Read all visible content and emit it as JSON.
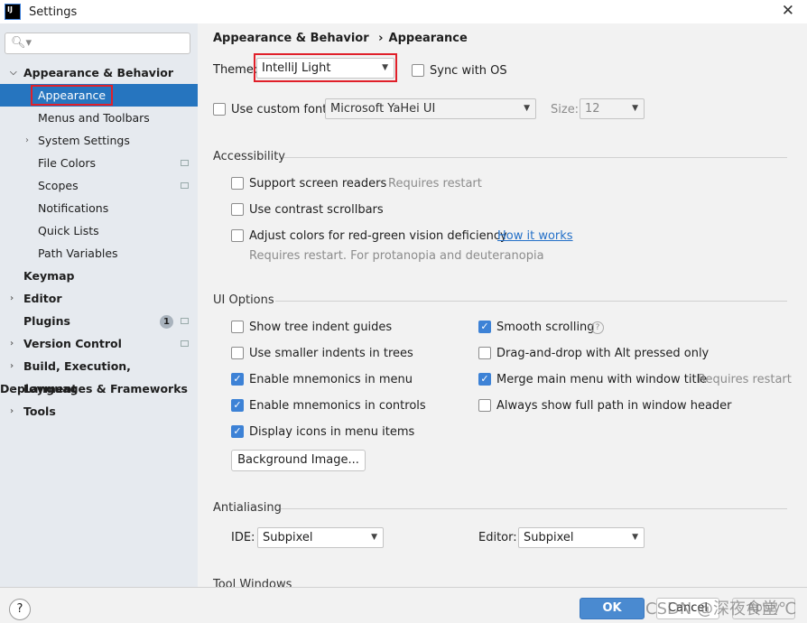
{
  "window": {
    "title": "Settings",
    "logo": "IJ"
  },
  "sidebar": {
    "search_placeholder": "",
    "items": [
      {
        "label": "Appearance & Behavior"
      },
      {
        "label": "Appearance"
      },
      {
        "label": "Menus and Toolbars"
      },
      {
        "label": "System Settings"
      },
      {
        "label": "File Colors"
      },
      {
        "label": "Scopes"
      },
      {
        "label": "Notifications"
      },
      {
        "label": "Quick Lists"
      },
      {
        "label": "Path Variables"
      },
      {
        "label": "Keymap"
      },
      {
        "label": "Editor"
      },
      {
        "label": "Plugins",
        "badge": "1"
      },
      {
        "label": "Version Control"
      },
      {
        "label": "Build, Execution, Deployment"
      },
      {
        "label": "Languages & Frameworks"
      },
      {
        "label": "Tools"
      }
    ]
  },
  "breadcrumb": {
    "parent": "Appearance & Behavior",
    "sep": "›",
    "current": "Appearance"
  },
  "theme": {
    "label": "Theme:",
    "value": "IntelliJ Light",
    "sync": "Sync with OS"
  },
  "font": {
    "label": "Use custom font:",
    "value": "Microsoft YaHei UI",
    "size_label": "Size:",
    "size": "12"
  },
  "accessibility": {
    "title": "Accessibility",
    "screen_readers": "Support screen readers",
    "requires_restart": "Requires restart",
    "contrast": "Use contrast scrollbars",
    "color_def": "Adjust colors for red-green vision deficiency",
    "how": "How it works",
    "note": "Requires restart. For protanopia and deuteranopia"
  },
  "ui": {
    "title": "UI Options",
    "left": [
      {
        "label": "Show tree indent guides",
        "checked": false
      },
      {
        "label": "Use smaller indents in trees",
        "checked": false
      },
      {
        "label": "Enable mnemonics in menu",
        "checked": true
      },
      {
        "label": "Enable mnemonics in controls",
        "checked": true
      },
      {
        "label": "Display icons in menu items",
        "checked": true
      }
    ],
    "right": [
      {
        "label": "Smooth scrolling",
        "checked": true
      },
      {
        "label": "Drag-and-drop with Alt pressed only",
        "checked": false
      },
      {
        "label": "Merge main menu with window title",
        "checked": true
      },
      {
        "label": "Always show full path in window header",
        "checked": false
      }
    ],
    "merge_note": "Requires restart",
    "bg_button": "Background Image..."
  },
  "antialiasing": {
    "title": "Antialiasing",
    "ide_label": "IDE:",
    "ide": "Subpixel",
    "editor_label": "Editor:",
    "editor": "Subpixel"
  },
  "tool_windows": {
    "title": "Tool Windows"
  },
  "footer": {
    "ok": "OK",
    "cancel": "Cancel",
    "apply": "Apply",
    "help": "?"
  },
  "watermark": "CSDN @深夜食堂℃",
  "colors": {
    "accent": "#2675bf",
    "highlight": "#e0202a"
  }
}
